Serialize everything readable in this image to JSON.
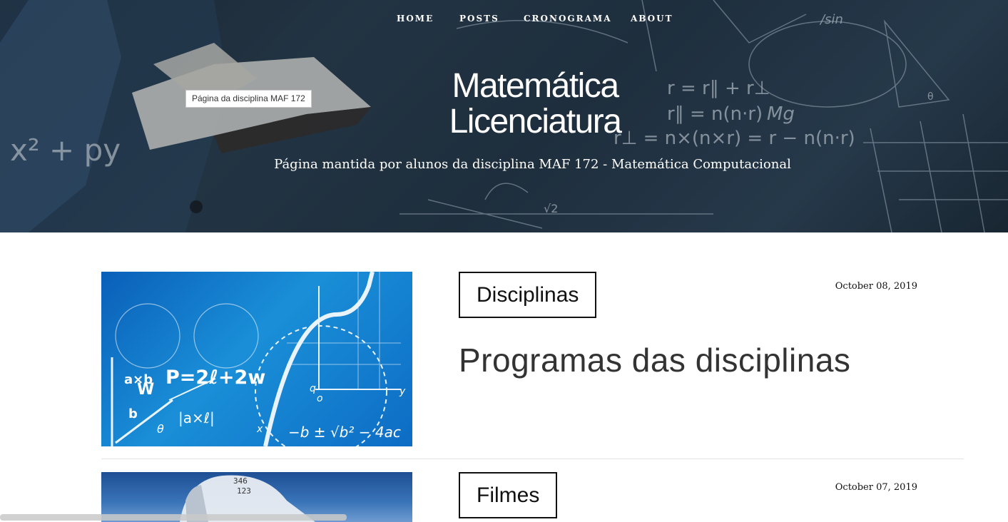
{
  "nav": {
    "home": "HOME",
    "posts": "POSTS",
    "cronograma": "CRONOGRAMA",
    "about": "ABOUT"
  },
  "hero": {
    "tooltip": "Página da disciplina MAF 172",
    "title_line1": "Matemática",
    "title_line2": "Licenciatura",
    "tagline": "Página mantida por alunos da disciplina MAF 172 - Matemática Computacional",
    "board_text": [
      "x² + py",
      "r = r∥ + r⊥",
      "r∥ = n(n·r)",
      "Mg",
      "r⊥ = n×(n×r) = r − n(n·r)",
      "/sin",
      "√2",
      "θ"
    ]
  },
  "posts": [
    {
      "tag": "Disciplinas",
      "date": "October 08, 2019",
      "title": "Programas das disciplinas",
      "image_text": [
        "P=2ℓ+2w",
        "a×b",
        "W",
        "b",
        "|a×ℓ|",
        "θ",
        "−b ± √b² − 4ac",
        "x",
        "y",
        "o",
        "q"
      ]
    },
    {
      "tag": "Filmes",
      "date": "October 07, 2019",
      "image_text": [
        "346",
        "123"
      ]
    }
  ],
  "colors": {
    "hero_bg": "#243646",
    "text_dark": "#111111",
    "title_gray": "#333333",
    "divider": "#e3e3e3",
    "post1_blue": "#1a8fd8"
  }
}
